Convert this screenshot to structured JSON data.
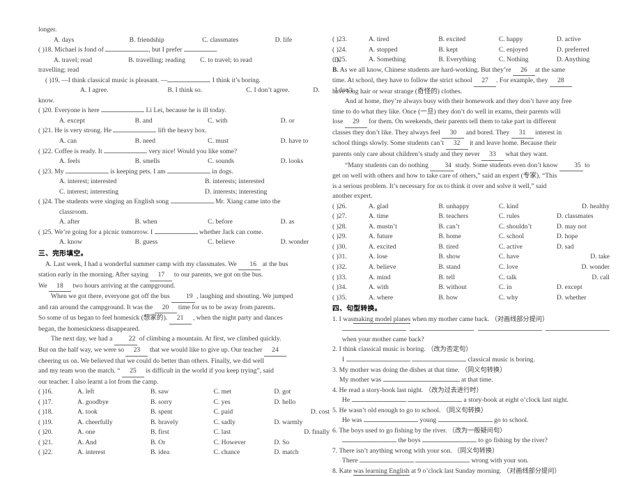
{
  "document": {
    "page_background": "#ffffff",
    "text_color": "#3b3b3b"
  },
  "left_column": {
    "q17_tail": "longer.",
    "q17_options": {
      "a": "A. days",
      "b": "B. friendship",
      "c": "C. classmates",
      "d": "D. life"
    },
    "q18": {
      "marker": "(            )18.",
      "stem_pre": "Michael is fond of",
      "stem_mid": ", but I prefer",
      "stem_post": ".",
      "opt_a": "A. travel; read",
      "opt_b": "B.  travelling;  reading",
      "opt_c": "C.  to travel;  to read",
      "opt_d": "D.",
      "wrap": "travelling; read"
    },
    "q19": {
      "marker": "(         )19.",
      "stem_pre": "—I think classical music is pleasant. —",
      "stem_post": "I think it’s boring.",
      "opt_a": "A. I agree.",
      "opt_b": "B. I think so.",
      "opt_c": "C. I don’t agree.",
      "opt_d": "D.",
      "opt_d2": "I    don’t",
      "wrap": "know."
    },
    "q20": {
      "marker": "(         )20.",
      "stem_pre": "Everyone is here",
      "stem_post": "Li Lei, because he is ill today.",
      "opt_a": "A. except",
      "opt_b": "B. and",
      "opt_c": "C. with",
      "opt_d": "D. or"
    },
    "q21": {
      "marker": "(         )21.",
      "stem_pre": "He is very strong. He",
      "stem_post": "lift the heavy box.",
      "opt_a": "A. can",
      "opt_b": "B. need",
      "opt_c": "C. must",
      "opt_d": "D. have to"
    },
    "q22": {
      "marker": "(         )22.",
      "stem_pre": "Coffee is ready. It",
      "stem_post": "very nice! Would you like some?",
      "opt_a": "A. feels",
      "opt_b": "B. smells",
      "opt_c": "C. sounds",
      "opt_d": "D. looks"
    },
    "q23": {
      "marker": "(         )23.",
      "stem_pre": "My",
      "stem_mid": "is keeping pets. I am",
      "stem_post": "in dogs.",
      "opt_a": "A. interest; interested",
      "opt_b": "B. interests; interested",
      "opt_c": "C. interest; interesting",
      "opt_d": "D. interests; interesting"
    },
    "q24": {
      "marker": "(        )24.",
      "stem_pre": "The students were singing an English song",
      "stem_post": "Mr. Xiang came into the",
      "wrap": "classroom.",
      "opt_a": "A. after",
      "opt_b": "B. when",
      "opt_c": "C. before",
      "opt_d": "D. as"
    },
    "q25": {
      "marker": "(        )25.",
      "stem_pre": "We’re going for a picnic tomorrow. I",
      "stem_post": "whether Jack can come.",
      "opt_a": "A. know",
      "opt_b": "B. guess",
      "opt_c": "C. believe",
      "opt_d": "D. wonder"
    },
    "section3_title": "三、完形填空。",
    "passage_a": {
      "label": "A.",
      "line1_pre": "Last week, I had a wonderful summer camp with my classmates. We",
      "blank16": "16",
      "line1_post": "at the bus",
      "line2_pre": "station early in the morning. After saying",
      "blank17": "17",
      "line2_post": "to our parents, we got on the bus.",
      "line3_pre": "We",
      "blank18": "18",
      "line3_post": "two hours arriving at the campground.",
      "para2_pre": "When we got there, everyone got off the bus",
      "blank19": "19",
      "para2_mid": ", laughing and shouting. We jumped",
      "para2_l2_pre": "and ran around the campground. It was the",
      "blank20": "20",
      "para2_l2_post": "time for us to be away from parents.",
      "para2_l3_pre": "So some of us began to feel homesick (想家的).",
      "blank21": "21",
      "para2_l3_post": ", when the night party and dances",
      "para2_l4": "began, the homesickness disappeared.",
      "para3_pre": "The next day, we had a",
      "blank22": "22",
      "para3_post": "of climbing a mountain. At first, we climbed quickly.",
      "para3_l2_pre": "But on the half way, we were so",
      "blank23": "23",
      "para3_l2_mid": "that we would like to give up. Our teacher",
      "blank24": "24",
      "para3_l3": "cheering us on. We believed that we could do better than others. Finally, we did well",
      "para3_l4_pre": "and my team won the match.  “",
      "blank25": "25",
      "para3_l4_post": "is difficult in the world if you keep trying”, said",
      "para3_l5": "our teacher. I also learnt a lot from the camp."
    },
    "cloze_options": [
      {
        "marker": "(      )16.",
        "a": "A. left",
        "b": "B. saw",
        "c": "C. met",
        "d": "D. got",
        "d_push": false
      },
      {
        "marker": "(      )17.",
        "a": "A. goodbye",
        "b": "B. sorry",
        "c": "C. yes",
        "d": "D. hello",
        "d_push": false
      },
      {
        "marker": "(      )18.",
        "a": "A. took",
        "b": "B. spent",
        "c": "C. paid",
        "d": "D. cost",
        "d_push": true
      },
      {
        "marker": "(      )19.",
        "a": "A. cheerfully",
        "b": "B. bravely",
        "c": "C. sadly",
        "d": "D. warmly",
        "d_push": false
      },
      {
        "marker": "(      )20.",
        "a": "A. one",
        "b": "B. first",
        "c": "C. last",
        "d": "D. finally",
        "d_push": true
      },
      {
        "marker": "(      )21.",
        "a": "A. And",
        "b": "B. Or",
        "c": "C. However",
        "d": "D. So",
        "d_push": false
      },
      {
        "marker": "(      )22.",
        "a": "A. interest",
        "b": "B. idea",
        "c": "C. chance",
        "d": "D. match",
        "d_push": false
      }
    ]
  },
  "right_column": {
    "cloze_options_top": [
      {
        "marker": "(      )23.",
        "a": "A. tired",
        "b": "B. excited",
        "c": "C. happy",
        "d": "D. active"
      },
      {
        "marker": "(      )24.",
        "a": "A. stopped",
        "b": "B. kept",
        "c": "C. enjoyed",
        "d": "D. preferred"
      },
      {
        "marker": "(      )25.",
        "a": "A. Something",
        "b": "B. Everything",
        "c": "C. Nothing",
        "d": "D. Anything"
      }
    ],
    "passage_b": {
      "label": "B.",
      "l1_pre": "As we all know, Chinese students are hard-working. But they’re",
      "blank26": "26",
      "l1_post": "at the same",
      "l2_pre": "time. At school, they have to follow the strict school",
      "blank27": "27",
      "l2_mid": ". For example, they",
      "blank28": "28",
      "l3": "have long hair or wear strange (奇怪的) clothes.",
      "p2_l1": "And at home, they’re always busy with their homework and they don’t have any free",
      "p2_l2": "time to do what they like. Once (一旦) they don’t do well in exams, their parents will",
      "p2_l3_pre": "lose",
      "blank29": "29",
      "p2_l3_post": "for them. On weekends, their parents tell them to take part in different",
      "p2_l4_pre": "classes they don’t like. They always feel",
      "blank30": "30",
      "p2_l4_mid": "and bored. They",
      "blank31": "31",
      "p2_l4_post": "interest in",
      "p2_l5_pre": "school things slowly. Some students can’t",
      "blank32": "32",
      "p2_l5_post": "it and leave home. Because their",
      "p2_l6_pre": "parents only care about children’s study and they never",
      "blank33": "33",
      "p2_l6_post": "what they want.",
      "p3_l1_pre": "“Many students can do nothing",
      "blank34": "34",
      "p3_l1_mid": "study. Some students even don’t know",
      "blank35": "35",
      "p3_l1_post": "to",
      "p3_l2": "get on well with others and how to take care of others,” said an expert (专家).  “This",
      "p3_l3": "is a serious problem. It’s necessary for us to think it over and solve it well,” said",
      "p3_l4": "another expert."
    },
    "cloze_options_bottom": [
      {
        "marker": "(      )26.",
        "a": "A. glad",
        "b": "B. unhappy",
        "c": "C. kind",
        "d": "D. healthy",
        "d_push": true
      },
      {
        "marker": "(      )27.",
        "a": "A. time",
        "b": "B. teachers",
        "c": "C. rules",
        "d": "D. classmates",
        "d_push": false
      },
      {
        "marker": "(      )28.",
        "a": "A. mustn’t",
        "b": "B. can’t",
        "c": "C. shouldn’t",
        "d": "D. may not",
        "d_push": false
      },
      {
        "marker": "(      )29.",
        "a": "A. future",
        "b": "B. home",
        "c": "C. school",
        "d": "D. hope",
        "d_push": false
      },
      {
        "marker": "(      )30.",
        "a": "A. excited",
        "b": "B. tired",
        "c": "C. active",
        "d": "D. sad",
        "d_push": false
      },
      {
        "marker": "(      )31.",
        "a": "A. lose",
        "b": "B. show",
        "c": "C. have",
        "d": "D. take",
        "d_push": true
      },
      {
        "marker": "(      )32.",
        "a": "A. believe",
        "b": "B. stand",
        "c": "C. love",
        "d": "D. wonder",
        "d_push": true
      },
      {
        "marker": "(      )33.",
        "a": "A. mind",
        "b": "B. tell",
        "c": "C. talk",
        "d": "D. call",
        "d_push": true
      },
      {
        "marker": "(      )34.",
        "a": "A. with",
        "b": "B. without",
        "c": "C. in",
        "d": "D. except",
        "d_push": false
      },
      {
        "marker": "(      )35.",
        "a": "A. where",
        "b": "B. how",
        "c": "C. why",
        "d": "D. whether",
        "d_push": false
      }
    ],
    "section4_title": "四、句型转换。",
    "transform": {
      "q1_num": "1.",
      "q1_pre": "I was",
      "q1_ul": "making model planes",
      "q1_post": "when my mother came back.",
      "q1_note": "（对画线部分提问）",
      "q1_ans_post": "when your mother came back?",
      "q2_num": "2.",
      "q2_text": "I think classical music is boring.",
      "q2_note": "（改为否定句）",
      "q2_ans_pre": "I",
      "q2_ans_post": "classical music is boring.",
      "q3_num": "3.",
      "q3_text": "My mother was doing the dishes at that time.",
      "q3_note": "（同义句转换）",
      "q3_ans_pre": "My mother was",
      "q3_ans_post": "at that time.",
      "q4_num": "4.",
      "q4_text": "He read a story-book last night.",
      "q4_note": "（改为过去进行时）",
      "q4_ans_pre": "He",
      "q4_ans_post": "a story-book at eight o’clock last night.",
      "q5_num": "5.",
      "q5_text": "He wasn’t old enough to go to school.",
      "q5_note": "（同义句转换）",
      "q5_ans_pre": "He was",
      "q5_ans_mid": "young",
      "q5_ans_post": "go to school.",
      "q6_num": "6.",
      "q6_text": "The boys used to go fishing by the river.",
      "q6_note": "（改为一般疑问句）",
      "q6_ans_mid": "the boys",
      "q6_ans_post": "to go fishing by the river?",
      "q7_num": "7.",
      "q7_text": "There isn’t anything wrong with your son.",
      "q7_note": "（同义句转换）",
      "q7_ans_pre": "There",
      "q7_ans_post": "wrong with your son.",
      "q8_num": "8.",
      "q8_pre": "Kate",
      "q8_ul": "was learning English",
      "q8_post": "at 9 o’clock last Sunday morning.",
      "q8_note": "（对画线部分提问）"
    }
  }
}
